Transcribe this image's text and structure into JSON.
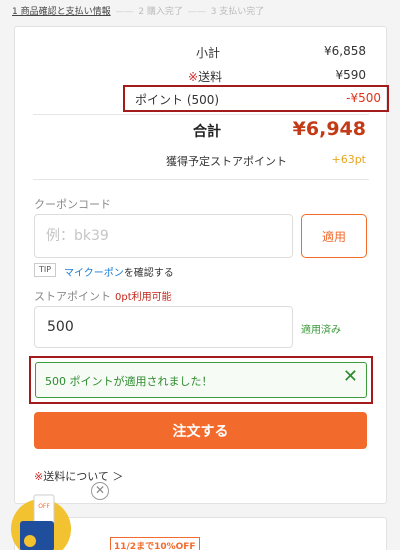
{
  "steps": [
    {
      "label": "1 商品確認と支払い情報"
    },
    {
      "label": "2 購入完了"
    },
    {
      "label": "3 支払い完了"
    }
  ],
  "step_separator": "——",
  "summary": {
    "subtotal_label": "小計",
    "subtotal_value": "¥6,858",
    "shipping_mark": "※",
    "shipping_label": "送料",
    "shipping_value": "¥590",
    "points_label": "ポイント (500)",
    "points_value": "-¥500",
    "total_label": "合計",
    "total_value": "¥6,948",
    "earn_label": "獲得予定ストアポイント",
    "earn_value": "+63pt"
  },
  "coupon": {
    "label": "クーポンコード",
    "placeholder": "例：bk39",
    "apply_label": "適用"
  },
  "tip": {
    "badge": "TIP",
    "link": "マイクーポン",
    "suffix": "を確認する"
  },
  "store_points": {
    "label": "ストアポイント",
    "available": "0pt利用可能",
    "value": "500",
    "applied": "適用済み"
  },
  "message": {
    "text": "500 ポイントが適用されました！",
    "close_icon": "✕"
  },
  "order_button": "注文する",
  "shipping_link": {
    "mark": "※",
    "text": "送料について ＞"
  },
  "float_close": "✕",
  "promo": {
    "badge": "11/2まで10%OFF",
    "icon_text": "OFF"
  },
  "colors": {
    "accent": "#f36b2c",
    "total": "#c23b16",
    "highlight_border": "#a31b1b",
    "success": "#2e8b2e",
    "link": "#1a7bd1"
  }
}
